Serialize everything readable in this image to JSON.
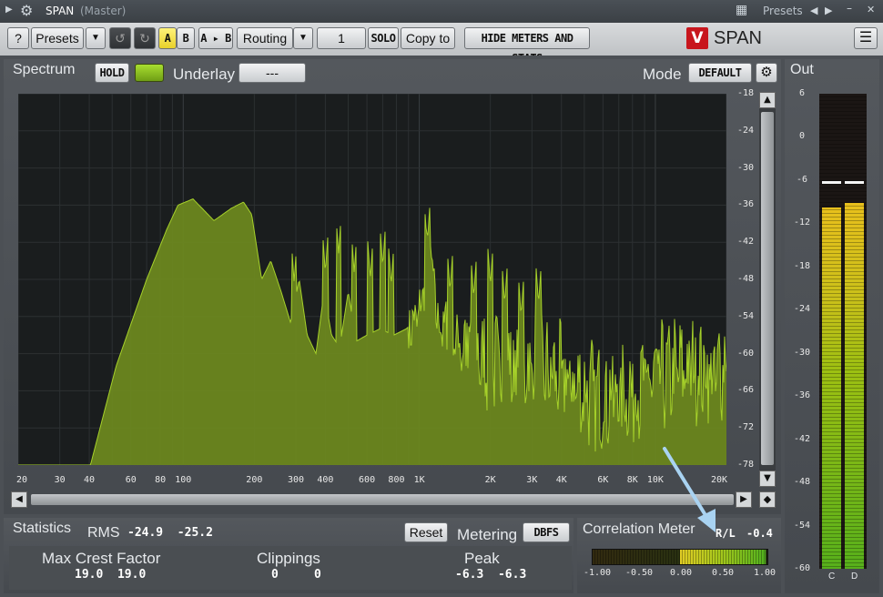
{
  "window": {
    "title": "SPAN",
    "subtitle": "(Master)",
    "presets_label": "Presets",
    "minimize": "–",
    "close": "✕"
  },
  "toolbar": {
    "help": "?",
    "presets": "Presets",
    "a": "A",
    "b": "B",
    "a_to_b": "A ▸ B",
    "routing": "Routing",
    "channel": "1",
    "solo": "SOLO",
    "copy_to": "Copy to",
    "hide_meters": "HIDE METERS AND STATS",
    "logo": "SPAN"
  },
  "spectrum": {
    "label": "Spectrum",
    "hold": "HOLD",
    "underlay_label": "Underlay",
    "underlay_value": "---",
    "mode_label": "Mode",
    "mode_value": "DEFAULT",
    "db_ticks": [
      "-18",
      "-24",
      "-30",
      "-36",
      "-42",
      "-48",
      "-54",
      "-60",
      "-66",
      "-72",
      "-78"
    ],
    "freq_ticks": [
      "20",
      "30",
      "40",
      "60",
      "80",
      "100",
      "200",
      "300",
      "400",
      "600",
      "800",
      "1K",
      "2K",
      "3K",
      "4K",
      "6K",
      "8K",
      "10K",
      "20K"
    ],
    "colors": {
      "fill": "#6e8a1e",
      "line": "#a6d12a",
      "grid": "#2c3032",
      "bg": "#1a1d1e"
    }
  },
  "out": {
    "label": "Out",
    "ticks": [
      "6",
      "0",
      "-6",
      "-12",
      "-18",
      "-24",
      "-30",
      "-36",
      "-42",
      "-48",
      "-54",
      "-60"
    ],
    "channels": [
      "C",
      "D"
    ],
    "level_db": [
      -9.8,
      -9.2
    ],
    "peak_db": [
      -6.3,
      -6.3
    ]
  },
  "statistics": {
    "label": "Statistics",
    "rms_label": "RMS",
    "rms_values": "-24.9  -25.2",
    "reset": "Reset",
    "metering_label": "Metering",
    "metering_value": "DBFS",
    "crest_label": "Max Crest Factor",
    "crest_values": "19.0  19.0",
    "clip_label": "Clippings",
    "clip_values": "0     0",
    "peak_label": "Peak",
    "peak_values": "-6.3  -6.3"
  },
  "correlation": {
    "label": "Correlation Meter",
    "mode": "R/L",
    "value": "-0.4",
    "ticks": [
      "-1.00",
      "-0.50",
      "0.00",
      "0.50",
      "1.00"
    ]
  }
}
